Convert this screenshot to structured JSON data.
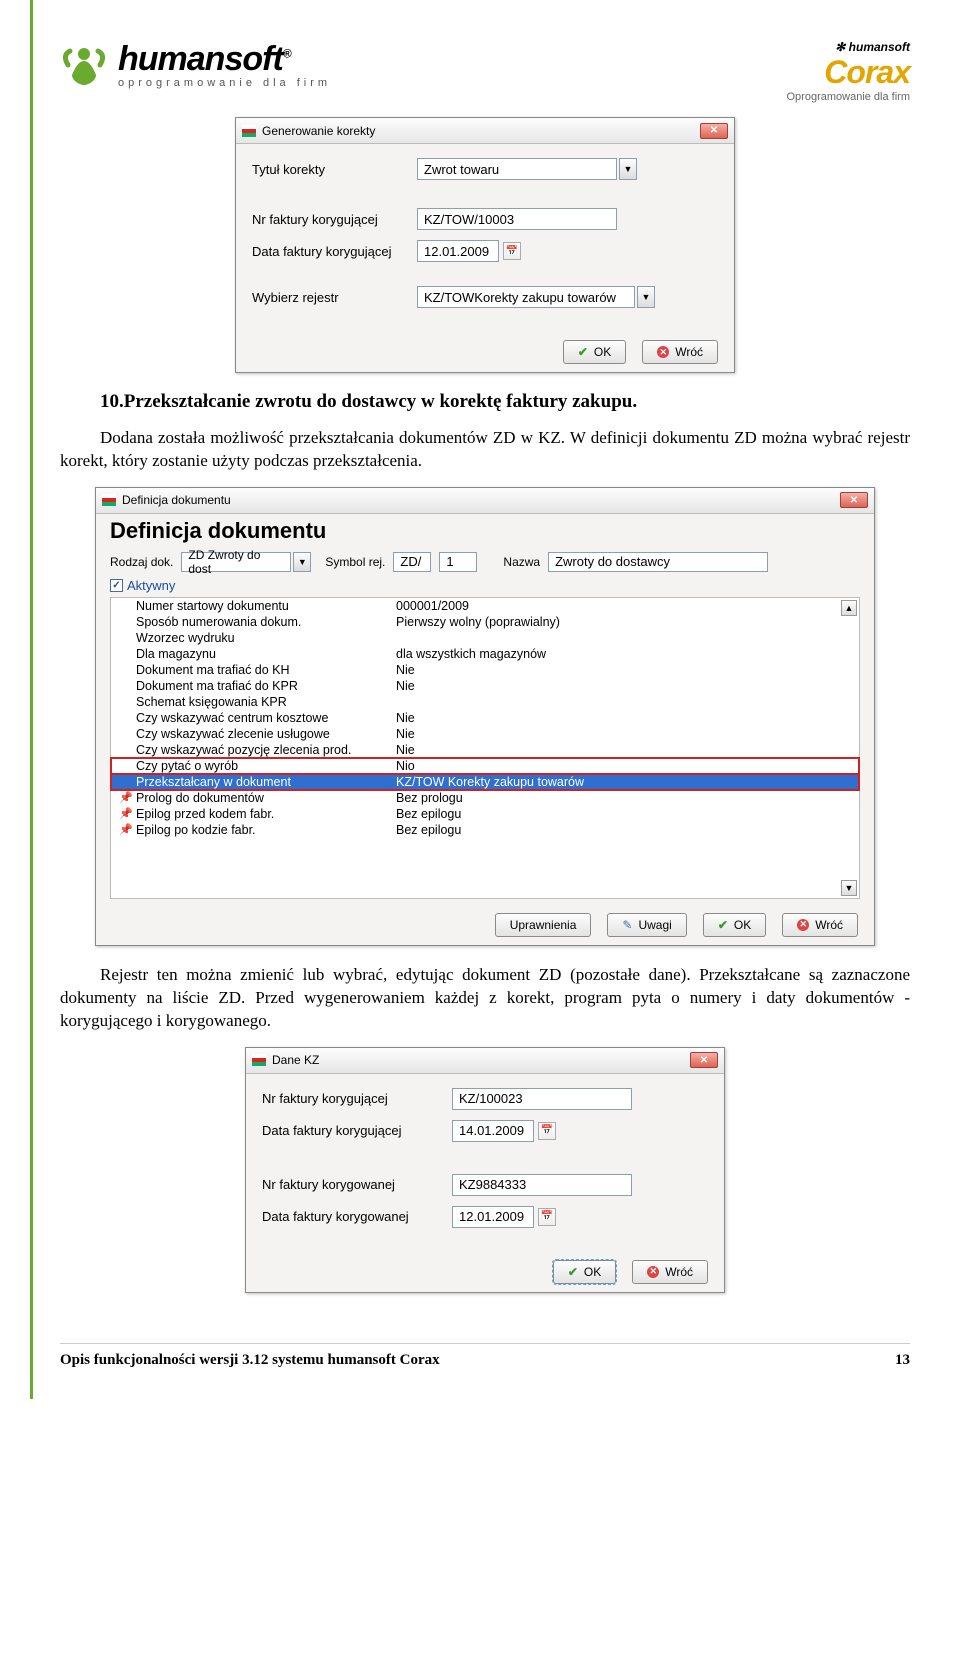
{
  "header": {
    "brand": "humansoft",
    "brand_reg": "®",
    "tagline": "oprogramowanie dla firm",
    "corax_small": "✻ humansoft",
    "corax": "Corax",
    "corax_tag": "Oprogramowanie dla firm"
  },
  "dlg1": {
    "title": "Generowanie korekty",
    "tytul_lbl": "Tytuł korekty",
    "tytul_val": "Zwrot towaru",
    "nr_lbl": "Nr faktury korygującej",
    "nr_val": "KZ/TOW/10003",
    "data_lbl": "Data faktury korygującej",
    "data_val": "12.01.2009",
    "rejestr_lbl": "Wybierz rejestr",
    "rejestr_val": "KZ/TOWKorekty zakupu towarów",
    "ok": "OK",
    "back": "Wróć"
  },
  "section_title": "10.Przekształcanie zwrotu do dostawcy w korektę faktury zakupu.",
  "para1": "Dodana została możliwość przekształcania dokumentów ZD w KZ. W definicji dokumentu ZD można wybrać rejestr korekt, który zostanie użyty podczas przekształcenia.",
  "dlg2": {
    "title": "Definicja dokumentu",
    "heading": "Definicja dokumentu",
    "rodzaj_lbl": "Rodzaj dok.",
    "rodzaj_val": "ZD Zwroty do dost",
    "symbol_lbl": "Symbol rej.",
    "symbol_val1": "ZD/",
    "symbol_val2": "1",
    "nazwa_lbl": "Nazwa",
    "nazwa_val": "Zwroty do dostawcy",
    "aktywny": "Aktywny",
    "props": [
      {
        "k": "Numer startowy dokumentu",
        "v": "000001/2009"
      },
      {
        "k": "Sposób numerowania dokum.",
        "v": "Pierwszy wolny  (poprawialny)"
      },
      {
        "k": "Wzorzec wydruku",
        "v": ""
      },
      {
        "k": "Dla magazynu",
        "v": "dla wszystkich magazynów"
      },
      {
        "k": "Dokument ma trafiać do KH",
        "v": "Nie"
      },
      {
        "k": "Dokument ma trafiać do KPR",
        "v": "Nie"
      },
      {
        "k": "Schemat księgowania KPR",
        "v": ""
      },
      {
        "k": "Czy wskazywać centrum kosztowe",
        "v": "Nie"
      },
      {
        "k": "Czy wskazywać zlecenie usługowe",
        "v": "Nie"
      },
      {
        "k": "Czy wskazywać pozycję zlecenia prod.",
        "v": "Nie"
      },
      {
        "k": "Czy pytać o wyrób",
        "v": "Nio"
      },
      {
        "k": "Przekształcany w dokument",
        "v": "KZ/TOW Korekty zakupu towarów",
        "sel": true
      },
      {
        "k": "Prolog do dokumentów",
        "v": "Bez prologu",
        "pin": true
      },
      {
        "k": "Epilog przed kodem fabr.",
        "v": "Bez epilogu",
        "pin": true
      },
      {
        "k": "Epilog po kodzie fabr.",
        "v": "Bez epilogu",
        "pin": true
      }
    ],
    "btn_upr": "Uprawnienia",
    "btn_uwagi": "Uwagi",
    "btn_ok": "OK",
    "btn_back": "Wróć"
  },
  "para2": "Rejestr ten można zmienić lub wybrać, edytując dokument ZD (pozostałe dane). Przekształcane są zaznaczone dokumenty na liście ZD. Przed wygenerowaniem każdej z korekt, program pyta o numery i daty dokumentów  - korygującego i korygowanego.",
  "dlg3": {
    "title": "Dane KZ",
    "nr1_lbl": "Nr faktury korygującej",
    "nr1_val": "KZ/100023",
    "d1_lbl": "Data faktury korygującej",
    "d1_val": "14.01.2009",
    "nr2_lbl": "Nr faktury korygowanej",
    "nr2_val": "KZ9884333",
    "d2_lbl": "Data faktury korygowanej",
    "d2_val": "12.01.2009",
    "ok": "OK",
    "back": "Wróć"
  },
  "footer": {
    "left": "Opis funkcjonalności wersji 3.12 systemu humansoft Corax",
    "right": "13"
  }
}
